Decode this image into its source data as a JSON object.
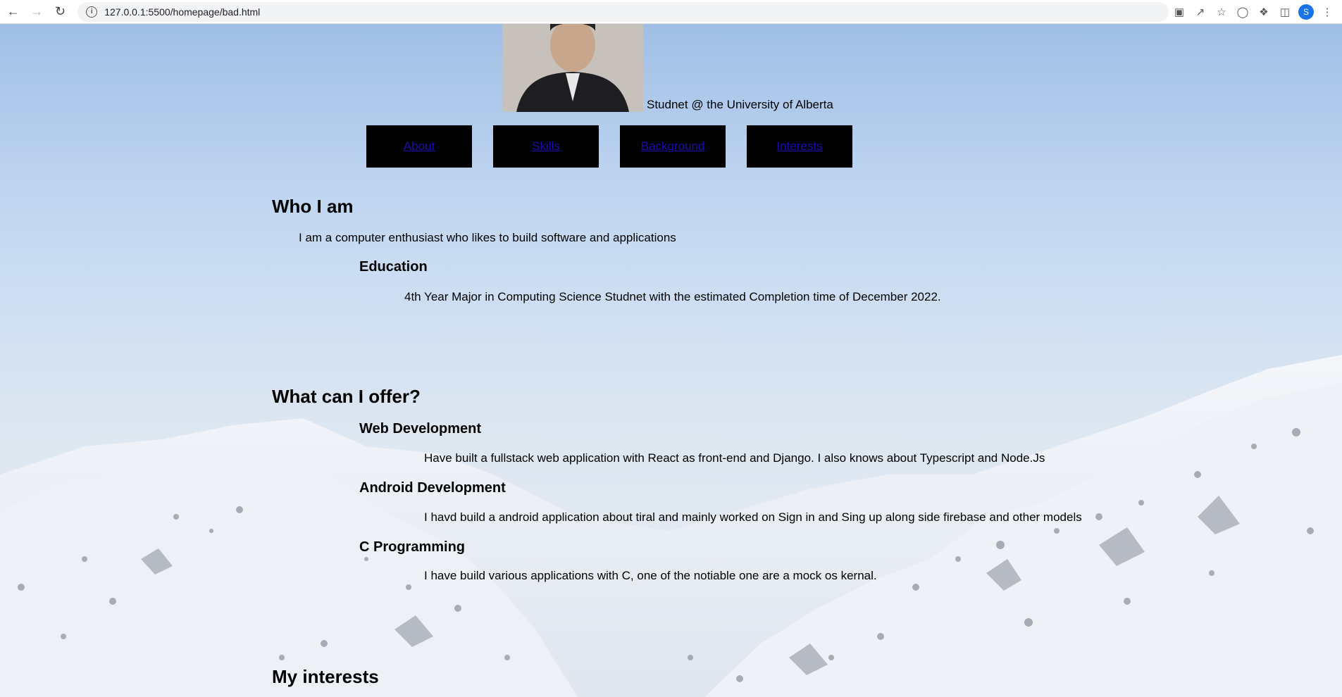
{
  "browser": {
    "url": "127.0.0.1:5500/homepage/bad.html",
    "profile_initial": "S"
  },
  "hero": {
    "tagline": "Studnet @ the University of Alberta"
  },
  "nav": {
    "about": "About",
    "skills": "Skills",
    "background": "Background",
    "interests": "Interests"
  },
  "who": {
    "heading": "Who I am",
    "intro": "I am a computer enthusiast who likes to build software and applications",
    "education_heading": "Education",
    "education_text": "4th Year Major in Computing Science Studnet with the estimated Completion time of December 2022."
  },
  "offer": {
    "heading": "What can I offer?",
    "items": [
      {
        "title": "Web Development",
        "text": "Have built a fullstack web application with React as front-end and Django. I also knows about Typescript and Node.Js"
      },
      {
        "title": "Android Development",
        "text": "I havd build a android application about tiral and mainly worked on Sign in and Sing up along side firebase and other models"
      },
      {
        "title": "C Programming",
        "text": "I have build various applications with C, one of the notiable one are a mock os kernal."
      }
    ]
  },
  "interests": {
    "heading": "My interests"
  }
}
